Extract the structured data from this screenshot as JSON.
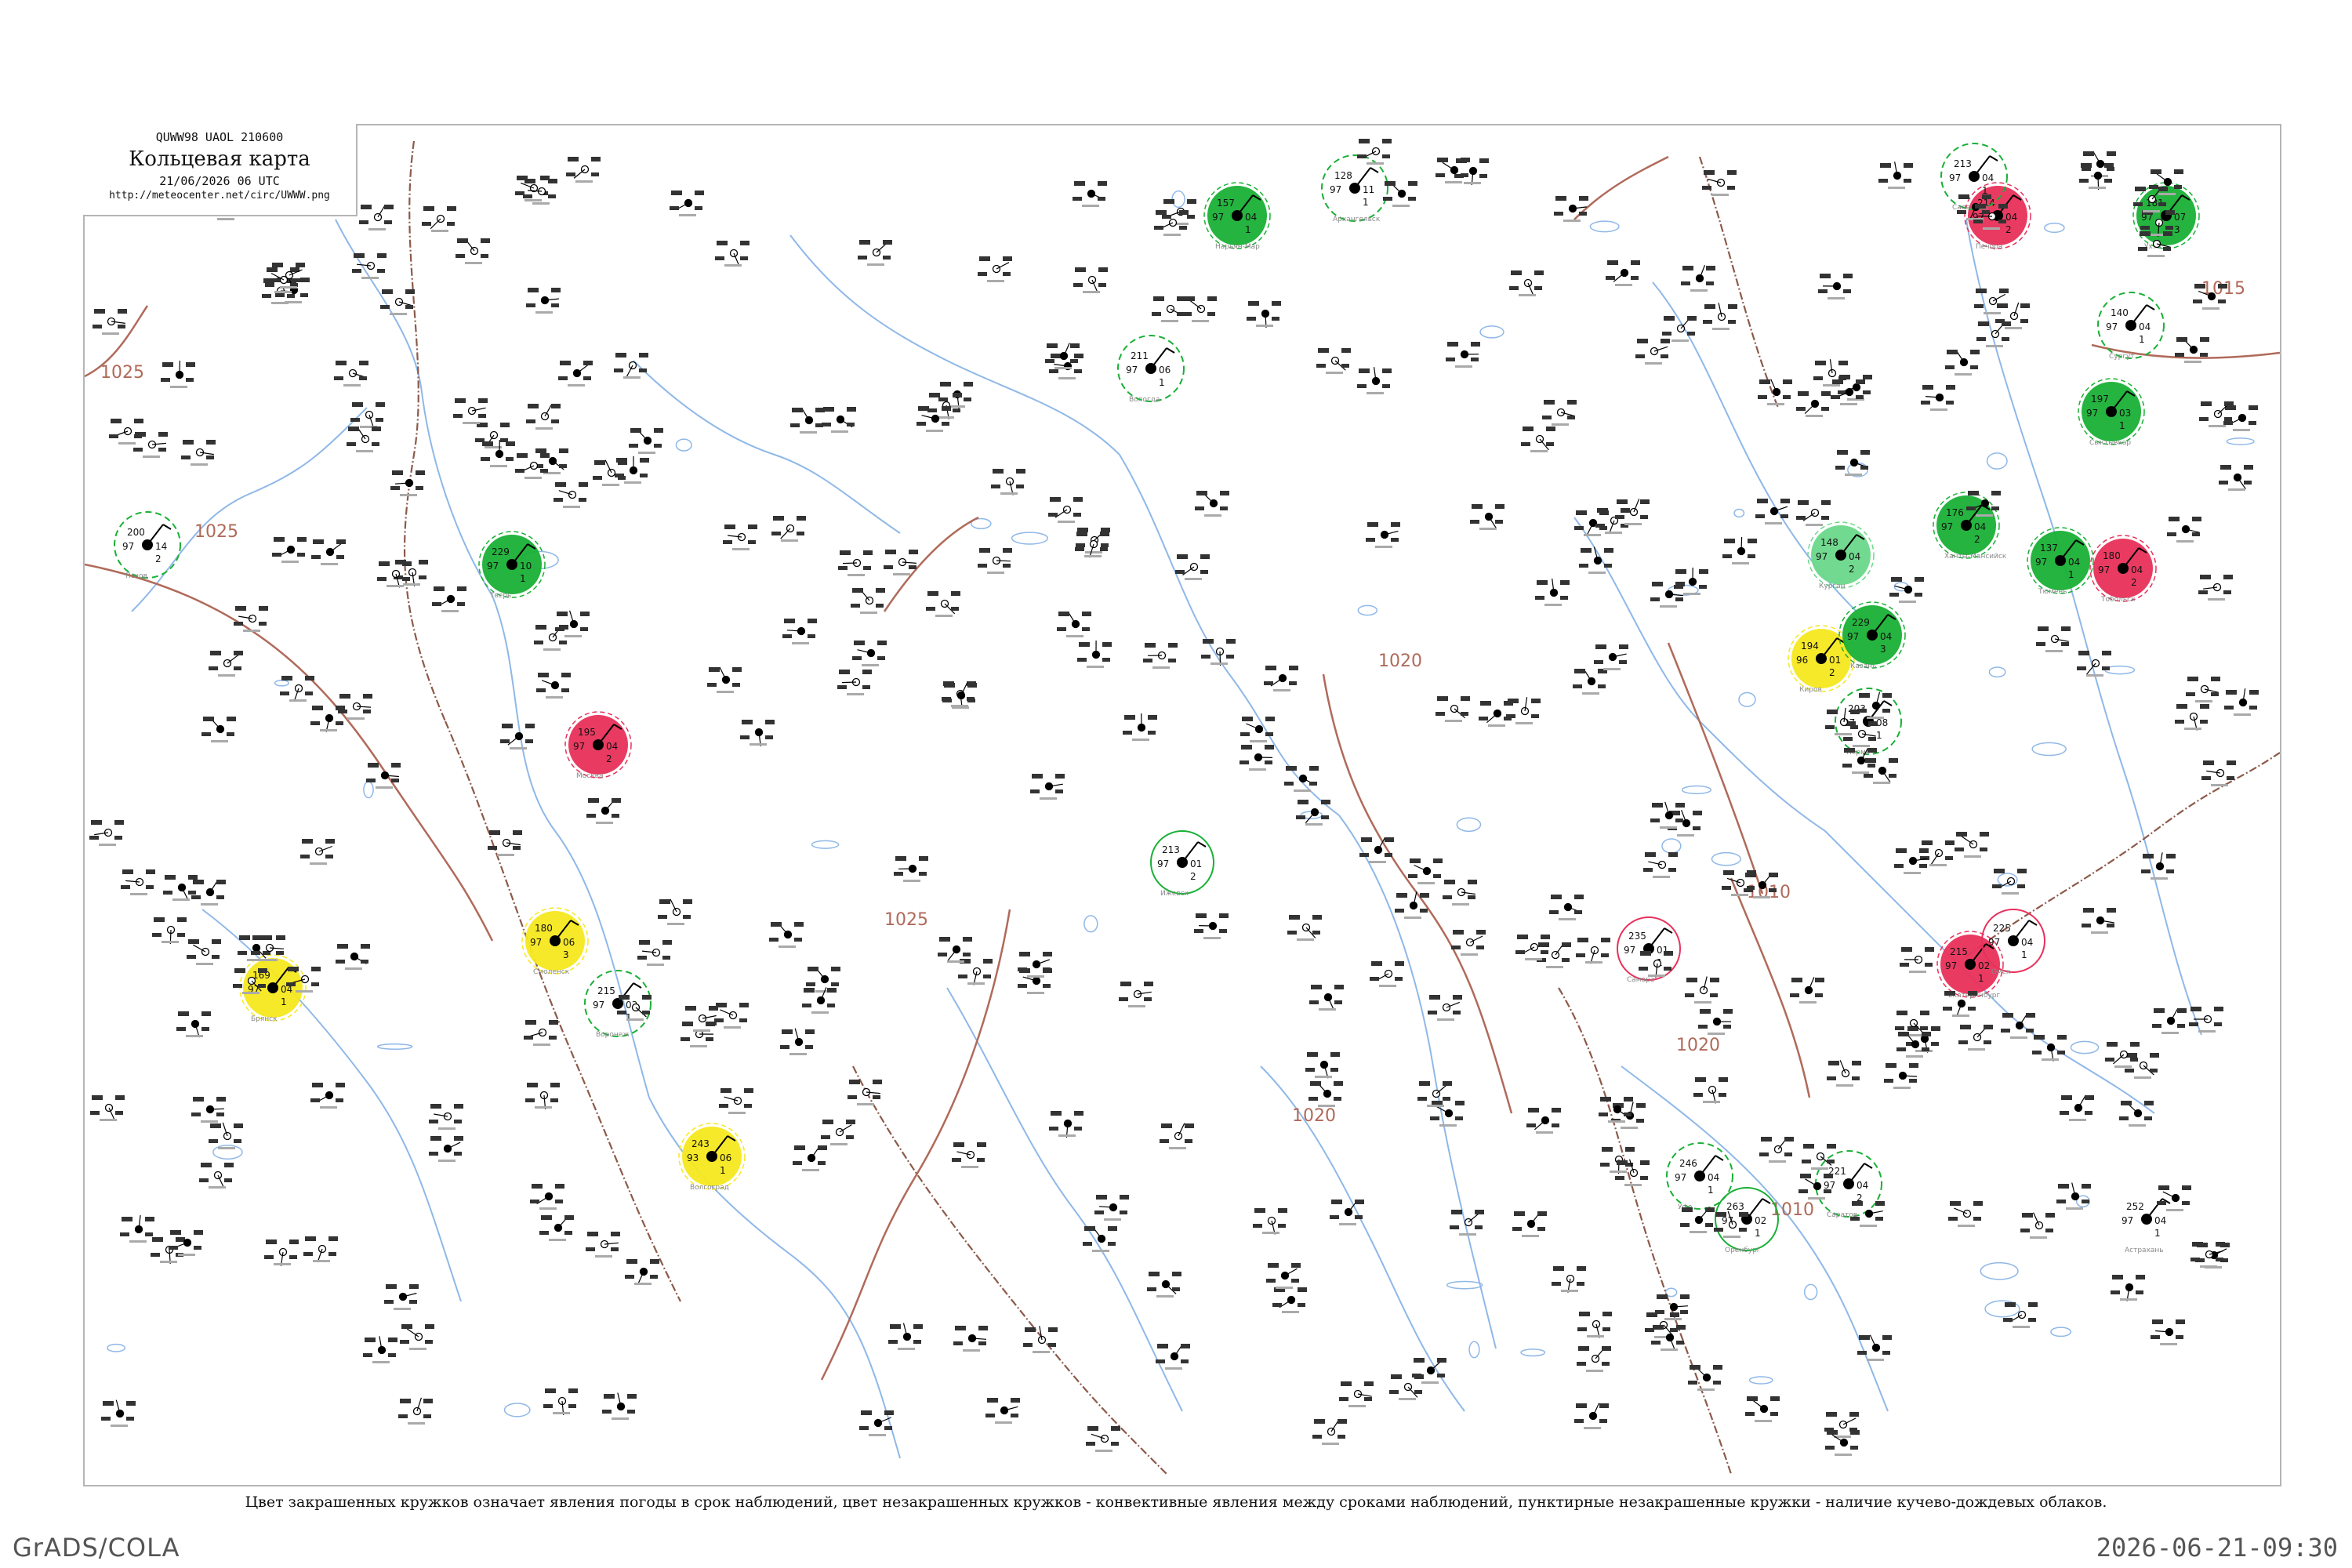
{
  "header": {
    "code": "QUWW98  UAOL  210600",
    "title": "Кольцевая карта",
    "date": "21/06/2026 06 UTC",
    "url": "http://meteocenter.net/circ/UWWW.png"
  },
  "caption": "Цвет закрашенных кружков означает явления погоды в срок наблюдений, цвет незакрашенных кружков - конвективные явления между сроками наблюдений, пунктирные незакрашенные кружки - наличие кучево-дождевых облаков.",
  "footer": {
    "software": "GrADS/COLA",
    "timestamp": "2026-06-21-09:30"
  },
  "colors": {
    "isobar": "#b06a5a",
    "river": "#8fb8e8",
    "border": "#8c5a4a",
    "thunder": "#19b035",
    "heavy": "#e8305a",
    "yellow": "#f5e81e",
    "lightgreen": "#6ad88a"
  },
  "isobar_labels": [
    "1025",
    "1025",
    "1025",
    "1020",
    "1020",
    "1020",
    "1015",
    "1010",
    "1010"
  ],
  "stations": [
    {
      "id": "ST01",
      "name": "Архангельск",
      "t": "128",
      "d": "97",
      "p": "11",
      "tt": "1",
      "marker": "thunder-dashed"
    },
    {
      "id": "ST02",
      "name": "Нарьян-Мар",
      "t": "157",
      "d": "97",
      "p": "04",
      "tt": "1",
      "marker": "thunder-fill"
    },
    {
      "id": "ST03",
      "name": "Печора",
      "t": "214",
      "d": "97",
      "p": "04",
      "tt": "2",
      "marker": "heavy-fill"
    },
    {
      "id": "ST04",
      "name": "Ухта",
      "t": "181",
      "d": "97",
      "p": "07",
      "tt": "3",
      "marker": "thunder-fill"
    },
    {
      "id": "ST05",
      "name": "Сыктывкар",
      "t": "197",
      "d": "97",
      "p": "03",
      "tt": "1",
      "marker": "thunder-fill"
    },
    {
      "id": "ST06",
      "name": "Киров",
      "t": "194",
      "d": "96",
      "p": "01",
      "tt": "2",
      "marker": "yellow-fill"
    },
    {
      "id": "ST07",
      "name": "Пермь",
      "t": "203",
      "d": "97",
      "p": "08",
      "tt": "1",
      "marker": "thunder-dashed"
    },
    {
      "id": "ST08",
      "name": "Екатеринбург",
      "t": "215",
      "d": "97",
      "p": "02",
      "tt": "1",
      "marker": "heavy-fill"
    },
    {
      "id": "ST09",
      "name": "Казань",
      "t": "229",
      "d": "97",
      "p": "04",
      "tt": "3",
      "marker": "thunder-fill"
    },
    {
      "id": "ST10",
      "name": "Самара",
      "t": "235",
      "d": "97",
      "p": "01",
      "tt": "1",
      "marker": "heavy-open"
    },
    {
      "id": "ST11",
      "name": "Саратов",
      "t": "221",
      "d": "97",
      "p": "04",
      "tt": "2",
      "marker": "thunder-dashed"
    },
    {
      "id": "ST12",
      "name": "Волгоград",
      "t": "243",
      "d": "93",
      "p": "06",
      "tt": "1",
      "marker": "yellow-fill"
    },
    {
      "id": "ST13",
      "name": "Воронеж",
      "t": "215",
      "d": "97",
      "p": "03",
      "tt": "1",
      "marker": "thunder-dashed"
    },
    {
      "id": "ST14",
      "name": "Москва",
      "t": "195",
      "d": "97",
      "p": "04",
      "tt": "2",
      "marker": "heavy-fill"
    },
    {
      "id": "ST15",
      "name": "Тверь",
      "t": "229",
      "d": "97",
      "p": "10",
      "tt": "1",
      "marker": "thunder-fill"
    },
    {
      "id": "ST16",
      "name": "Смоленск",
      "t": "180",
      "d": "97",
      "p": "06",
      "tt": "3",
      "marker": "yellow-fill"
    },
    {
      "id": "ST17",
      "name": "Брянск",
      "t": "169",
      "d": "97",
      "p": "04",
      "tt": "1",
      "marker": "yellow-fill"
    },
    {
      "id": "ST18",
      "name": "Псков",
      "t": "200",
      "d": "97",
      "p": "14",
      "tt": "2",
      "marker": "thunder-dashed"
    },
    {
      "id": "ST19",
      "name": "Вологда",
      "t": "211",
      "d": "97",
      "p": "06",
      "tt": "1",
      "marker": "thunder-dashed"
    },
    {
      "id": "ST20",
      "name": "Ижевск",
      "t": "213",
      "d": "97",
      "p": "01",
      "tt": "2",
      "marker": "thunder-open"
    },
    {
      "id": "ST21",
      "name": "Уфа",
      "t": "246",
      "d": "97",
      "p": "04",
      "tt": "1",
      "marker": "thunder-dashed"
    },
    {
      "id": "ST22",
      "name": "Оренбург",
      "t": "263",
      "d": "97",
      "p": "02",
      "tt": "1",
      "marker": "thunder-open"
    },
    {
      "id": "ST23",
      "name": "Астрахань",
      "t": "252",
      "d": "97",
      "p": "04",
      "tt": "1",
      "marker": "none"
    },
    {
      "id": "ST24",
      "name": "Курган",
      "t": "148",
      "d": "97",
      "p": "04",
      "tt": "2",
      "marker": "lightgreen-fill"
    },
    {
      "id": "ST25",
      "name": "Тюмень",
      "t": "137",
      "d": "97",
      "p": "04",
      "tt": "1",
      "marker": "thunder-fill"
    },
    {
      "id": "ST26",
      "name": "Салехард",
      "t": "213",
      "d": "97",
      "p": "04",
      "tt": "1",
      "marker": "thunder-dashed"
    },
    {
      "id": "ST27",
      "name": "Ханты-Мансийск",
      "t": "176",
      "d": "97",
      "p": "04",
      "tt": "2",
      "marker": "thunder-fill"
    },
    {
      "id": "ST28",
      "name": "Сургут",
      "t": "140",
      "d": "97",
      "p": "04",
      "tt": "1",
      "marker": "thunder-dashed"
    },
    {
      "id": "ST29",
      "name": "Тобольск",
      "t": "180",
      "d": "97",
      "p": "04",
      "tt": "2",
      "marker": "heavy-fill"
    },
    {
      "id": "ST30",
      "name": "Омск",
      "t": "225",
      "d": "97",
      "p": "04",
      "tt": "1",
      "marker": "heavy-open"
    }
  ]
}
